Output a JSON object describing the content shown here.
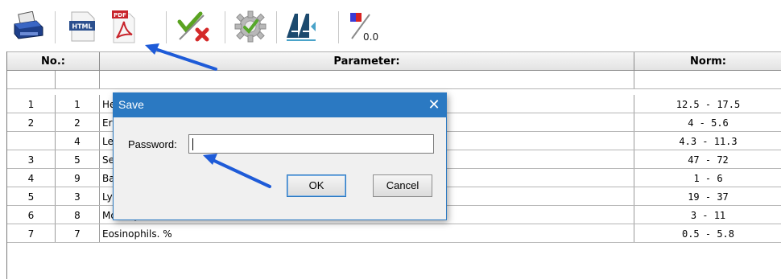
{
  "toolbar": {
    "buttons": [
      {
        "icon": "printer-icon"
      },
      {
        "icon": "html-export-icon",
        "badge": "HTML"
      },
      {
        "icon": "pdf-export-icon",
        "badge": "PDF"
      },
      {
        "icon": "check-cross-icon"
      },
      {
        "icon": "settings-gear-icon"
      },
      {
        "icon": "font-style-icon"
      },
      {
        "icon": "decimal-format-icon",
        "badge": "0.0"
      }
    ]
  },
  "table": {
    "headers": {
      "no": "No.:",
      "parameter": "Parameter:",
      "norm": "Norm:"
    },
    "rows": [
      {
        "no": "",
        "id": "",
        "parameter": "",
        "norm": ""
      },
      {
        "no": "1",
        "id": "1",
        "parameter": "He",
        "norm": "12.5 - 17.5"
      },
      {
        "no": "2",
        "id": "2",
        "parameter": "Er",
        "norm": "4 - 5.6"
      },
      {
        "no": "",
        "id": "4",
        "parameter": "Le",
        "norm": "4.3 - 11.3"
      },
      {
        "no": "3",
        "id": "5",
        "parameter": "Se",
        "norm": "47 - 72"
      },
      {
        "no": "4",
        "id": "9",
        "parameter": "Ba",
        "norm": "1 - 6"
      },
      {
        "no": "5",
        "id": "3",
        "parameter": "Lymphocytes. LYMPH %",
        "norm": "19 - 37"
      },
      {
        "no": "6",
        "id": "8",
        "parameter": "Monocytes.MONO %",
        "norm": "3 - 11"
      },
      {
        "no": "7",
        "id": "7",
        "parameter": "Eosinophils. %",
        "norm": "0.5 - 5.8"
      }
    ]
  },
  "dialog": {
    "title": "Save",
    "close": "✕",
    "password_label": "Password:",
    "password_value": "",
    "ok_label": "OK",
    "cancel_label": "Cancel"
  },
  "colors": {
    "accent": "#2b79c2",
    "arrow": "#1e5bd8"
  }
}
